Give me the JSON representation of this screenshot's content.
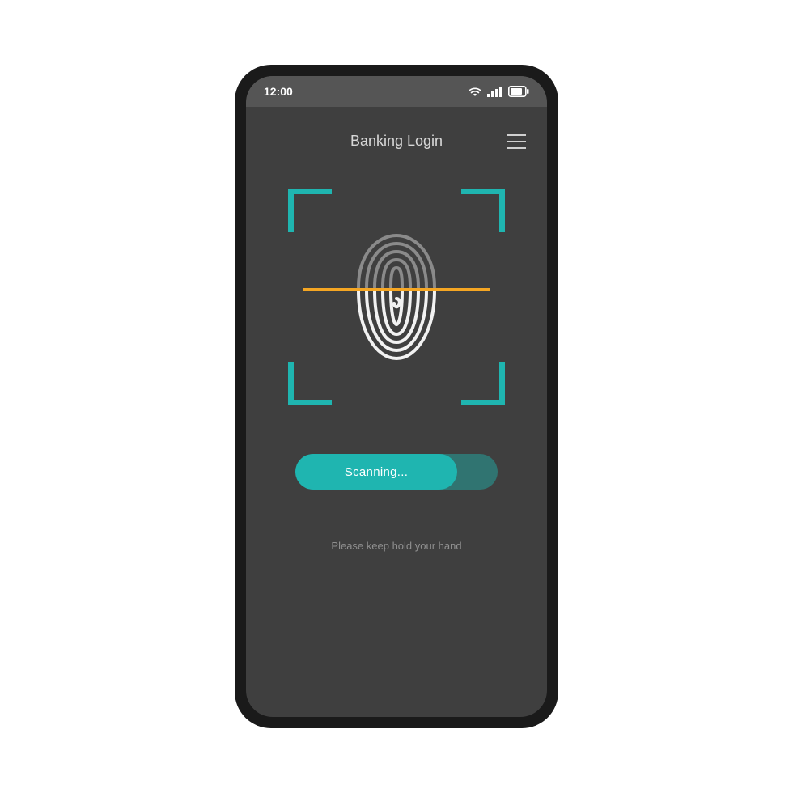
{
  "statusbar": {
    "time": "12:00"
  },
  "header": {
    "title": "Banking Login"
  },
  "scan": {
    "button_label": "Scanning...",
    "hint": "Please keep hold your hand"
  },
  "icons": {
    "wifi": "wifi-icon",
    "signal": "signal-icon",
    "battery": "battery-icon",
    "menu": "menu-icon",
    "fingerprint": "fingerprint-icon"
  },
  "colors": {
    "accent": "#1fb5b0",
    "scanline": "#f5a623",
    "bg": "#3f3f3f"
  }
}
